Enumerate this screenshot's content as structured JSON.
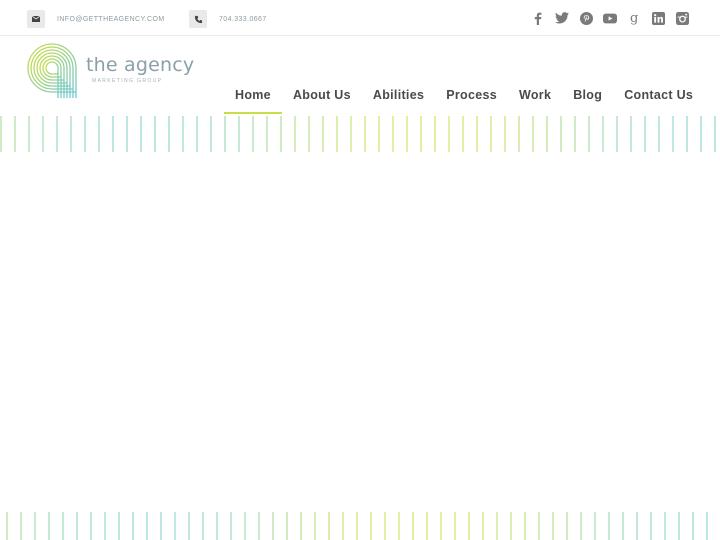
{
  "topbar": {
    "email": {
      "icon": "envelope-icon",
      "text": "INFO@GETTHEAGENCY.COM"
    },
    "phone": {
      "icon": "phone-icon",
      "text": "704.333.0667"
    },
    "social": [
      {
        "name": "facebook-icon"
      },
      {
        "name": "twitter-icon"
      },
      {
        "name": "pinterest-icon"
      },
      {
        "name": "youtube-icon"
      },
      {
        "name": "google-plus-icon"
      },
      {
        "name": "linkedin-icon"
      },
      {
        "name": "instagram-icon"
      }
    ]
  },
  "logo": {
    "name": "the agency",
    "tagline": "MARKETING GROUP"
  },
  "nav": {
    "items": [
      {
        "label": "Home",
        "active": true
      },
      {
        "label": "About Us"
      },
      {
        "label": "Abilities"
      },
      {
        "label": "Process"
      },
      {
        "label": "Work"
      },
      {
        "label": "Blog"
      },
      {
        "label": "Contact Us"
      }
    ]
  },
  "colors": {
    "accent_green": "#c9de46",
    "accent_teal": "#7ccfc7",
    "icon_gray": "#7a7a7a"
  }
}
